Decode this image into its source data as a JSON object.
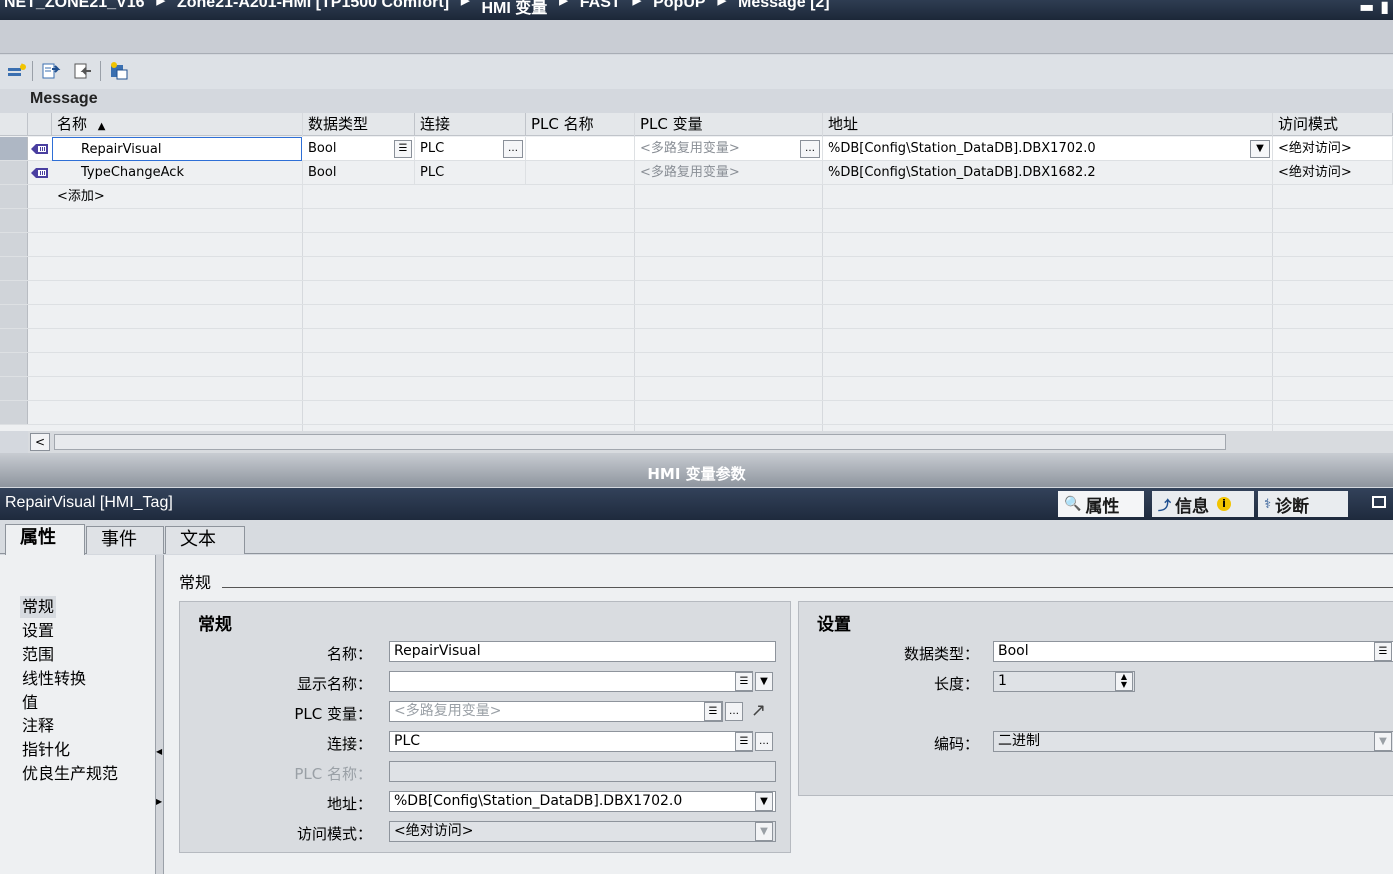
{
  "breadcrumb": [
    "NET_ZONE21_V16",
    "Zone21-A201-HMI [TP1500 Comfort]",
    "HMI 变量",
    "FAST",
    "PopUP",
    "Message [2]"
  ],
  "window_controls": {
    "minimize": "▬",
    "restore": "▮"
  },
  "toolbar": {
    "icons": [
      "add-tag-icon",
      "export-icon",
      "import-icon",
      "discrepancy-icon"
    ]
  },
  "table": {
    "title": "Message",
    "columns": [
      "名称",
      "数据类型",
      "连接",
      "PLC 名称",
      "PLC 变量",
      "地址",
      "访问模式"
    ],
    "sort_indicator": "▲",
    "rows": [
      {
        "name": "RepairVisual",
        "datatype": "Bool",
        "connection": "PLC",
        "plc_name": "",
        "plc_tag": "<多路复用变量>",
        "address": "%DB[Config\\Station_DataDB].DBX1702.0",
        "access": "<绝对访问>"
      },
      {
        "name": "TypeChangeAck",
        "datatype": "Bool",
        "connection": "PLC",
        "plc_name": "",
        "plc_tag": "<多路复用变量>",
        "address": "%DB[Config\\Station_DataDB].DBX1682.2",
        "access": "<绝对访问>"
      }
    ],
    "add_row": "<添加>"
  },
  "splitter_label": "HMI 变量参数",
  "inspector": {
    "title": "RepairVisual [HMI_Tag]",
    "tabs": [
      "属性",
      "信息",
      "诊断"
    ],
    "info_badge": "i",
    "subtabs": [
      "属性",
      "事件",
      "文本"
    ],
    "nav": [
      "常规",
      "设置",
      "范围",
      "线性转换",
      "值",
      "注释",
      "指针化",
      "优良生产规范"
    ],
    "section": "常规",
    "general": {
      "title": "常规",
      "name_label": "名称：",
      "name_value": "RepairVisual",
      "display_label": "显示名称：",
      "display_value": "",
      "plctag_label": "PLC 变量：",
      "plctag_value": "<多路复用变量>",
      "conn_label": "连接：",
      "conn_value": "PLC",
      "plcname_label": "PLC 名称：",
      "plcname_value": "",
      "addr_label": "地址：",
      "addr_value": "%DB[Config\\Station_DataDB].DBX1702.0",
      "access_label": "访问模式：",
      "access_value": "<绝对访问>"
    },
    "settings": {
      "title": "设置",
      "dtype_label": "数据类型：",
      "dtype_value": "Bool",
      "len_label": "长度：",
      "len_value": "1",
      "enc_label": "编码：",
      "enc_value": "二进制"
    }
  }
}
